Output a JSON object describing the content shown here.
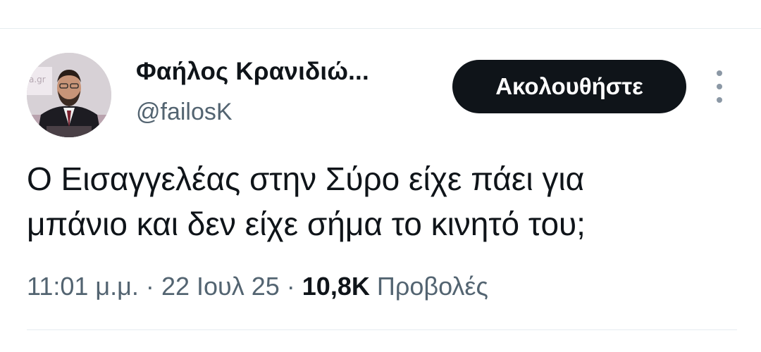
{
  "author": {
    "display_name": "Φαήλος Κρανιδιώ...",
    "handle": "@failosK",
    "avatar_watermark": "a.gr"
  },
  "actions": {
    "follow_label": "Ακολουθήστε",
    "more_icon": "more-vertical-icon"
  },
  "tweet": {
    "text_lines": [
      "Ο Εισαγγελέας στην Σύρο είχε πάει για",
      "μπάνιο και δεν είχε σήμα το κινητό του;"
    ],
    "time": "11:01 μ.μ.",
    "separator": "·",
    "date": "22 Ιουλ 25",
    "views_count": "10,8K",
    "views_label": "Προβολές"
  },
  "colors": {
    "text_primary": "#0f1419",
    "text_secondary": "#536471",
    "button_bg": "#0f1419",
    "button_text": "#ffffff",
    "divider": "#e6ecf0"
  }
}
